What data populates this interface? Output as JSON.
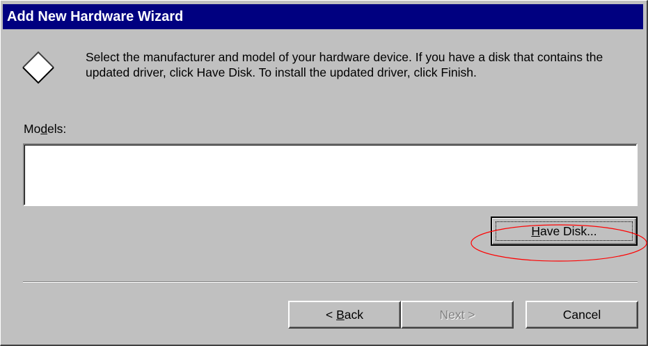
{
  "window": {
    "title": "Add New Hardware Wizard"
  },
  "instructions": "Select the manufacturer and model of your hardware device. If you have a disk that contains the updated driver, click Have Disk. To install the updated driver, click Finish.",
  "models": {
    "label_pre": "Mo",
    "label_mnemonic": "d",
    "label_post": "els:",
    "items": []
  },
  "buttons": {
    "have_disk": {
      "mnemonic": "H",
      "rest": "ave Disk..."
    },
    "back": {
      "prefix": "< ",
      "mnemonic": "B",
      "rest": "ack"
    },
    "next": {
      "label": "Next >",
      "enabled": false
    },
    "cancel": {
      "label": "Cancel"
    }
  },
  "colors": {
    "titlebar": "#000080",
    "face": "#c0c0c0",
    "annotation": "#ff0000"
  },
  "icons": {
    "wizard": "diamond-icon"
  }
}
